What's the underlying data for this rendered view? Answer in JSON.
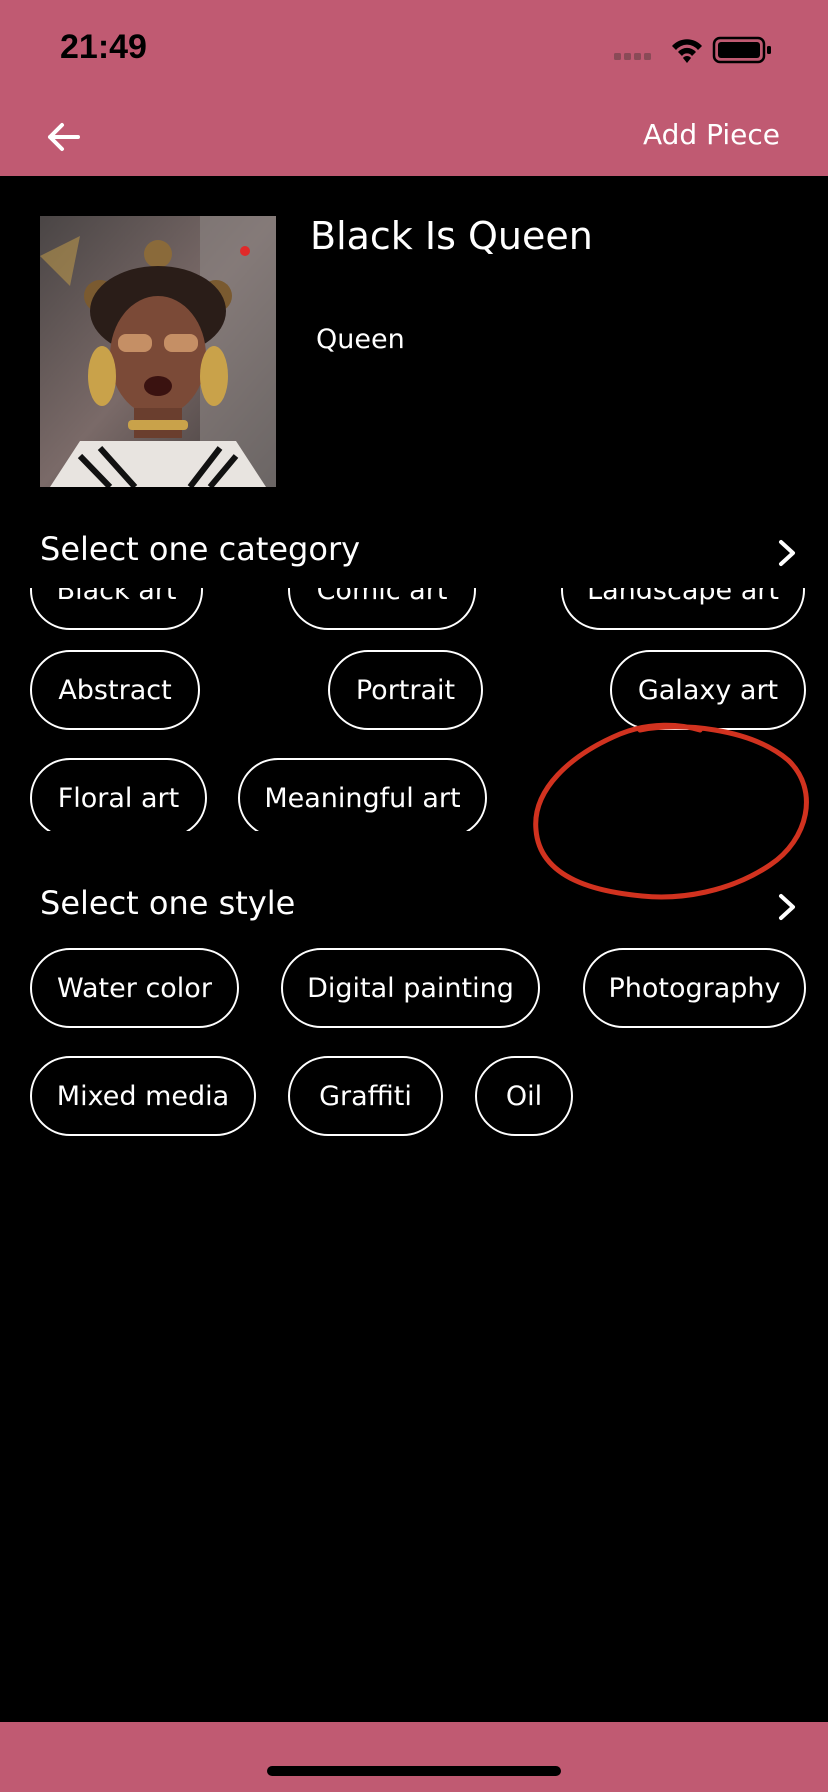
{
  "status_bar": {
    "time": "21:49"
  },
  "header": {
    "action_label": "Add Piece"
  },
  "artwork": {
    "title": "Black Is Queen",
    "subtitle": "Queen"
  },
  "category_section": {
    "label": "Select one category",
    "chips": [
      "Black art",
      "Comic art",
      "Landscape art",
      "Abstract",
      "Portrait",
      "Galaxy art",
      "Floral art",
      "Meaningful art"
    ]
  },
  "style_section": {
    "label": "Select one style",
    "chips": [
      "Water color",
      "Digital painting",
      "Photography",
      "Mixed media",
      "Graffiti",
      "Oil"
    ]
  },
  "colors": {
    "accent": "#C05A72",
    "background": "#000000",
    "annotation": "#D1321F"
  }
}
